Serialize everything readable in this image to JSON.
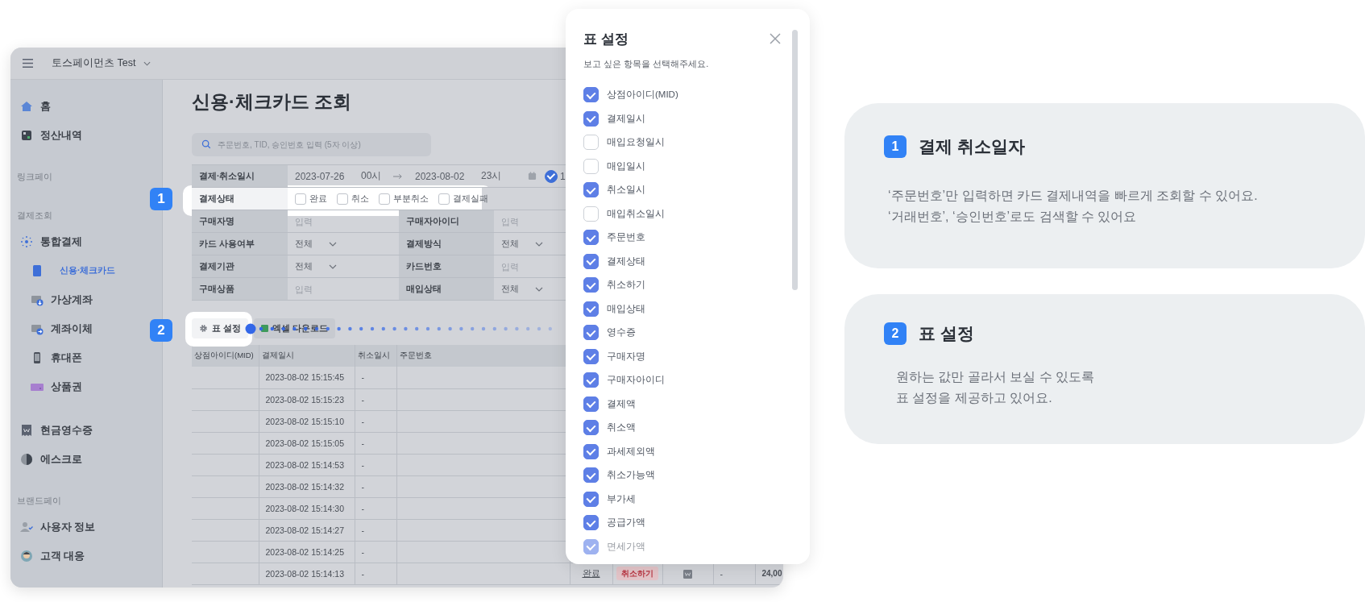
{
  "window": {
    "workspace": "토스페이먼츠 Test"
  },
  "sidebar": {
    "groups": [
      {
        "items": [
          {
            "label": "홈",
            "selected": false
          },
          {
            "label": "정산내역",
            "selected": false
          }
        ]
      },
      {
        "heading": "링크페이"
      },
      {
        "heading": "결제조회",
        "items": [
          {
            "label": "통합결제",
            "selected": false,
            "children": [
              {
                "label": "신용·체크카드",
                "selected": true
              },
              {
                "label": "가상계좌",
                "selected": false
              },
              {
                "label": "계좌이체",
                "selected": false
              },
              {
                "label": "휴대폰",
                "selected": false
              },
              {
                "label": "상품권",
                "selected": false
              }
            ]
          },
          {
            "label": "현금영수증",
            "selected": false
          },
          {
            "label": "에스크로",
            "selected": false
          }
        ]
      },
      {
        "heading": "브랜드페이",
        "items": [
          {
            "label": "사용자 정보",
            "selected": false
          },
          {
            "label": "고객 대응",
            "selected": false
          }
        ]
      }
    ]
  },
  "page": {
    "title": "신용·체크카드 조회",
    "search": {
      "placeholder": "주문번호, TID, 승인번호 입력 (5자 이상)"
    }
  },
  "filters": [
    {
      "kind": "daterange",
      "label": "결제·취소일시",
      "start_date": "2023-07-26",
      "start_hour": "00시",
      "end_date": "2023-08-02",
      "end_hour": "23시",
      "preset": {
        "label": "1",
        "selected": true
      }
    },
    {
      "kind": "checkboxes",
      "label": "결제상태",
      "options": [
        {
          "label": "완료",
          "checked": false
        },
        {
          "label": "취소",
          "checked": false
        },
        {
          "label": "부분취소",
          "checked": false
        },
        {
          "label": "결제실패",
          "checked": false
        }
      ]
    },
    {
      "kind": "pair",
      "fields": [
        {
          "kind": "input",
          "label": "구매자명",
          "placeholder": "입력"
        },
        {
          "kind": "input",
          "label": "구매자아이디",
          "placeholder": "입력"
        }
      ]
    },
    {
      "kind": "pair",
      "fields": [
        {
          "kind": "select",
          "label": "카드 사용여부",
          "value": "전체"
        },
        {
          "kind": "select",
          "label": "결제방식",
          "value": "전체"
        }
      ]
    },
    {
      "kind": "pair",
      "fields": [
        {
          "kind": "select",
          "label": "결제기관",
          "value": "전체"
        },
        {
          "kind": "input",
          "label": "카드번호",
          "placeholder": "입력"
        }
      ]
    },
    {
      "kind": "pair",
      "fields": [
        {
          "kind": "input",
          "label": "구매상품",
          "placeholder": "입력"
        },
        {
          "kind": "select",
          "label": "매입상태",
          "value": "전체"
        }
      ]
    }
  ],
  "toolbar": {
    "buttons": [
      {
        "kind": "settings",
        "label": "표 설정"
      },
      {
        "kind": "excel",
        "label": "엑셀 다운로드"
      }
    ]
  },
  "table": {
    "columns": [
      "상점아이디(MID)",
      "결제일시",
      "취소일시",
      "주문번호"
    ],
    "rows": [
      {
        "paid_at": "2023-08-02 15:15:45",
        "cancelled_at": "-"
      },
      {
        "paid_at": "2023-08-02 15:15:23",
        "cancelled_at": "-"
      },
      {
        "paid_at": "2023-08-02 15:15:10",
        "cancelled_at": "-"
      },
      {
        "paid_at": "2023-08-02 15:15:05",
        "cancelled_at": "-"
      },
      {
        "paid_at": "2023-08-02 15:14:53",
        "cancelled_at": "-"
      },
      {
        "paid_at": "2023-08-02 15:14:32",
        "cancelled_at": "-"
      },
      {
        "paid_at": "2023-08-02 15:14:30",
        "cancelled_at": "-"
      },
      {
        "paid_at": "2023-08-02 15:14:27",
        "cancelled_at": "-"
      },
      {
        "paid_at": "2023-08-02 15:14:25",
        "cancelled_at": "-"
      },
      {
        "paid_at": "2023-08-02 15:14:13",
        "cancelled_at": "-",
        "status": "완료",
        "cancel_button": "취소하기",
        "column_9": "-",
        "amount": "24,00"
      }
    ]
  },
  "markers": [
    {
      "number": "1"
    },
    {
      "number": "2"
    }
  ],
  "modal": {
    "title": "표 설정",
    "subtitle": "보고 싶은 항목을 선택해주세요.",
    "options": [
      {
        "label": "상점아이디(MID)",
        "checked": true
      },
      {
        "label": "결제일시",
        "checked": true
      },
      {
        "label": "매입요청일시",
        "checked": false
      },
      {
        "label": "매입일시",
        "checked": false
      },
      {
        "label": "취소일시",
        "checked": true
      },
      {
        "label": "매입취소일시",
        "checked": false
      },
      {
        "label": "주문번호",
        "checked": true
      },
      {
        "label": "결제상태",
        "checked": true
      },
      {
        "label": "취소하기",
        "checked": true
      },
      {
        "label": "매입상태",
        "checked": true
      },
      {
        "label": "영수증",
        "checked": true
      },
      {
        "label": "구매자명",
        "checked": true
      },
      {
        "label": "구매자아이디",
        "checked": true
      },
      {
        "label": "결제액",
        "checked": true
      },
      {
        "label": "취소액",
        "checked": true
      },
      {
        "label": "과세제외액",
        "checked": true
      },
      {
        "label": "취소가능액",
        "checked": true
      },
      {
        "label": "부가세",
        "checked": true
      },
      {
        "label": "공급가액",
        "checked": true
      },
      {
        "label": "면세가액",
        "checked": true
      }
    ]
  },
  "cards": [
    {
      "number": "1",
      "title": "결제 취소일자",
      "lines": [
        "‘주문번호’만 입력하면 카드 결제내역을 빠르게 조회할 수 있어요.",
        "‘거래번호’, ‘승인번호’로도 검색할 수 있어요"
      ]
    },
    {
      "number": "2",
      "title": "표 설정",
      "lines": [
        "원하는 값만 골라서 보실 수 있도록",
        "표 설정을 제공하고 있어요."
      ]
    }
  ]
}
